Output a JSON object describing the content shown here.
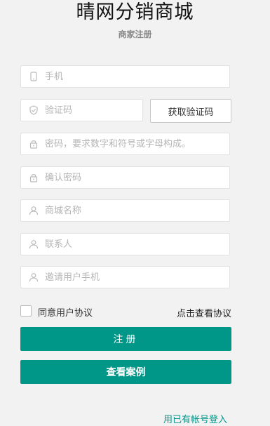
{
  "header": {
    "title": "晴网分销商城",
    "subtitle": "商家注册"
  },
  "form": {
    "phone": {
      "placeholder": "手机",
      "icon": "phone-icon"
    },
    "code": {
      "placeholder": "验证码",
      "icon": "shield-icon"
    },
    "get_code_label": "获取验证码",
    "password": {
      "placeholder": "密码，要求数字和符号或字母构成。",
      "icon": "lock-icon"
    },
    "confirm_password": {
      "placeholder": "确认密码",
      "icon": "lock-icon"
    },
    "shop_name": {
      "placeholder": "商城名称",
      "icon": "user-icon"
    },
    "contact": {
      "placeholder": "联系人",
      "icon": "user-icon"
    },
    "inviter_phone": {
      "placeholder": "邀请用户手机",
      "icon": "user-icon"
    },
    "agree_label": "同意用户协议",
    "view_protocol": "点击查看协议",
    "register_label": "注册",
    "cases_label": "查看案例",
    "login_link": "用已有帐号登入"
  },
  "colors": {
    "accent": "#009688",
    "background": "#f2f2f2",
    "placeholder": "#b5b5b5"
  }
}
